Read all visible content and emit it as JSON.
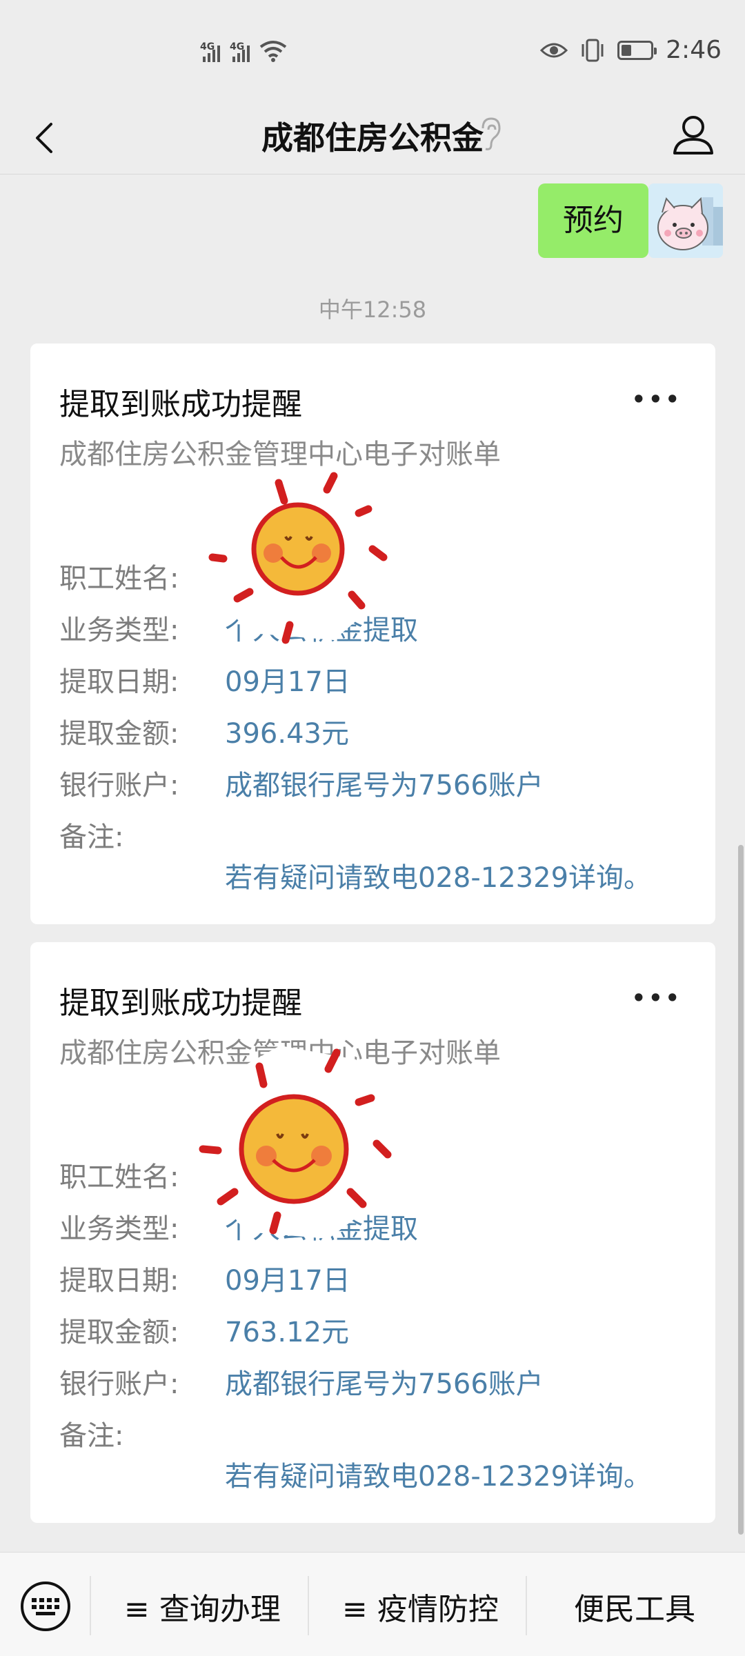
{
  "status": {
    "time": "2:46",
    "net1": "4G",
    "net2": "4G",
    "battery_level": 0.35
  },
  "header": {
    "title": "成都住房公积金"
  },
  "chat": {
    "sent_message": "预约",
    "timestamp": "中午12:58"
  },
  "cards": [
    {
      "title": "提取到账成功提醒",
      "more": "•••",
      "subtitle": "成都住房公积金管理中心电子对账单",
      "fields": [
        {
          "label": "职工姓名:",
          "value": ""
        },
        {
          "label": "业务类型:",
          "value": "个人公积金提取"
        },
        {
          "label": "提取日期:",
          "value": "09月17日"
        },
        {
          "label": "提取金额:",
          "value": "396.43元"
        },
        {
          "label": "银行账户:",
          "value": "成都银行尾号为7566账户"
        },
        {
          "label": "备注:",
          "value": ""
        }
      ],
      "note": "若有疑问请致电028-12329详询。"
    },
    {
      "title": "提取到账成功提醒",
      "more": "•••",
      "subtitle": "成都住房公积金管理中心电子对账单",
      "fields": [
        {
          "label": "职工姓名:",
          "value": ""
        },
        {
          "label": "业务类型:",
          "value": "个人公积金提取"
        },
        {
          "label": "提取日期:",
          "value": "09月17日"
        },
        {
          "label": "提取金额:",
          "value": "763.12元"
        },
        {
          "label": "银行账户:",
          "value": "成都银行尾号为7566账户"
        },
        {
          "label": "备注:",
          "value": ""
        }
      ],
      "note": "若有疑问请致电028-12329详询。"
    }
  ],
  "bottom_menu": [
    {
      "label": "≡ 查询办理"
    },
    {
      "label": "≡ 疫情防控"
    },
    {
      "label": "便民工具"
    }
  ],
  "icons": [
    "back-arrow-icon",
    "ear-icon",
    "profile-icon",
    "keyboard-icon",
    "sun-sticker",
    "pig-avatar",
    "eye-icon",
    "vibrate-icon",
    "battery-icon",
    "wifi-icon",
    "signal-icon"
  ]
}
